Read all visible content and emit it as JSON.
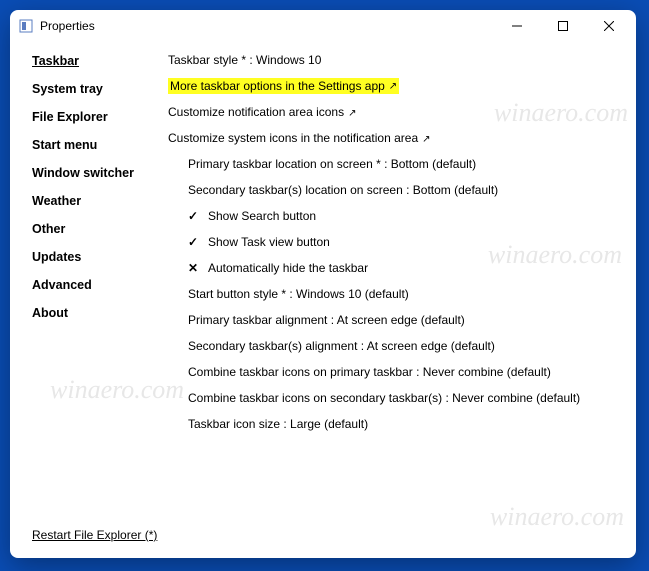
{
  "window": {
    "title": "Properties"
  },
  "sidebar": {
    "items": [
      {
        "label": "Taskbar",
        "active": true
      },
      {
        "label": "System tray"
      },
      {
        "label": "File Explorer"
      },
      {
        "label": "Start menu"
      },
      {
        "label": "Window switcher"
      },
      {
        "label": "Weather"
      },
      {
        "label": "Other"
      },
      {
        "label": "Updates"
      },
      {
        "label": "Advanced"
      },
      {
        "label": "About"
      }
    ]
  },
  "content": {
    "rows": [
      {
        "text": "Taskbar style * : Windows 10",
        "indent": false
      },
      {
        "text": "More taskbar options in the Settings app",
        "indent": false,
        "arrow": true,
        "highlight": true
      },
      {
        "text": "Customize notification area icons",
        "indent": false,
        "arrow": true
      },
      {
        "text": "Customize system icons in the notification area",
        "indent": false,
        "arrow": true
      },
      {
        "text": "Primary taskbar location on screen * : Bottom (default)",
        "indent": true
      },
      {
        "text": "Secondary taskbar(s) location on screen : Bottom (default)",
        "indent": true
      },
      {
        "text": "Show Search button",
        "indent": true,
        "mark": "check"
      },
      {
        "text": "Show Task view button",
        "indent": true,
        "mark": "check"
      },
      {
        "text": "Automatically hide the taskbar",
        "indent": true,
        "mark": "cross"
      },
      {
        "text": "Start button style * : Windows 10 (default)",
        "indent": true
      },
      {
        "text": "Primary taskbar alignment : At screen edge (default)",
        "indent": true
      },
      {
        "text": "Secondary taskbar(s) alignment : At screen edge (default)",
        "indent": true
      },
      {
        "text": "Combine taskbar icons on primary taskbar : Never combine (default)",
        "indent": true
      },
      {
        "text": "Combine taskbar icons on secondary taskbar(s) : Never combine (default)",
        "indent": true
      },
      {
        "text": "Taskbar icon size : Large (default)",
        "indent": true
      }
    ]
  },
  "footer": {
    "restart": "Restart File Explorer (*)"
  },
  "watermark": "winaero.com"
}
